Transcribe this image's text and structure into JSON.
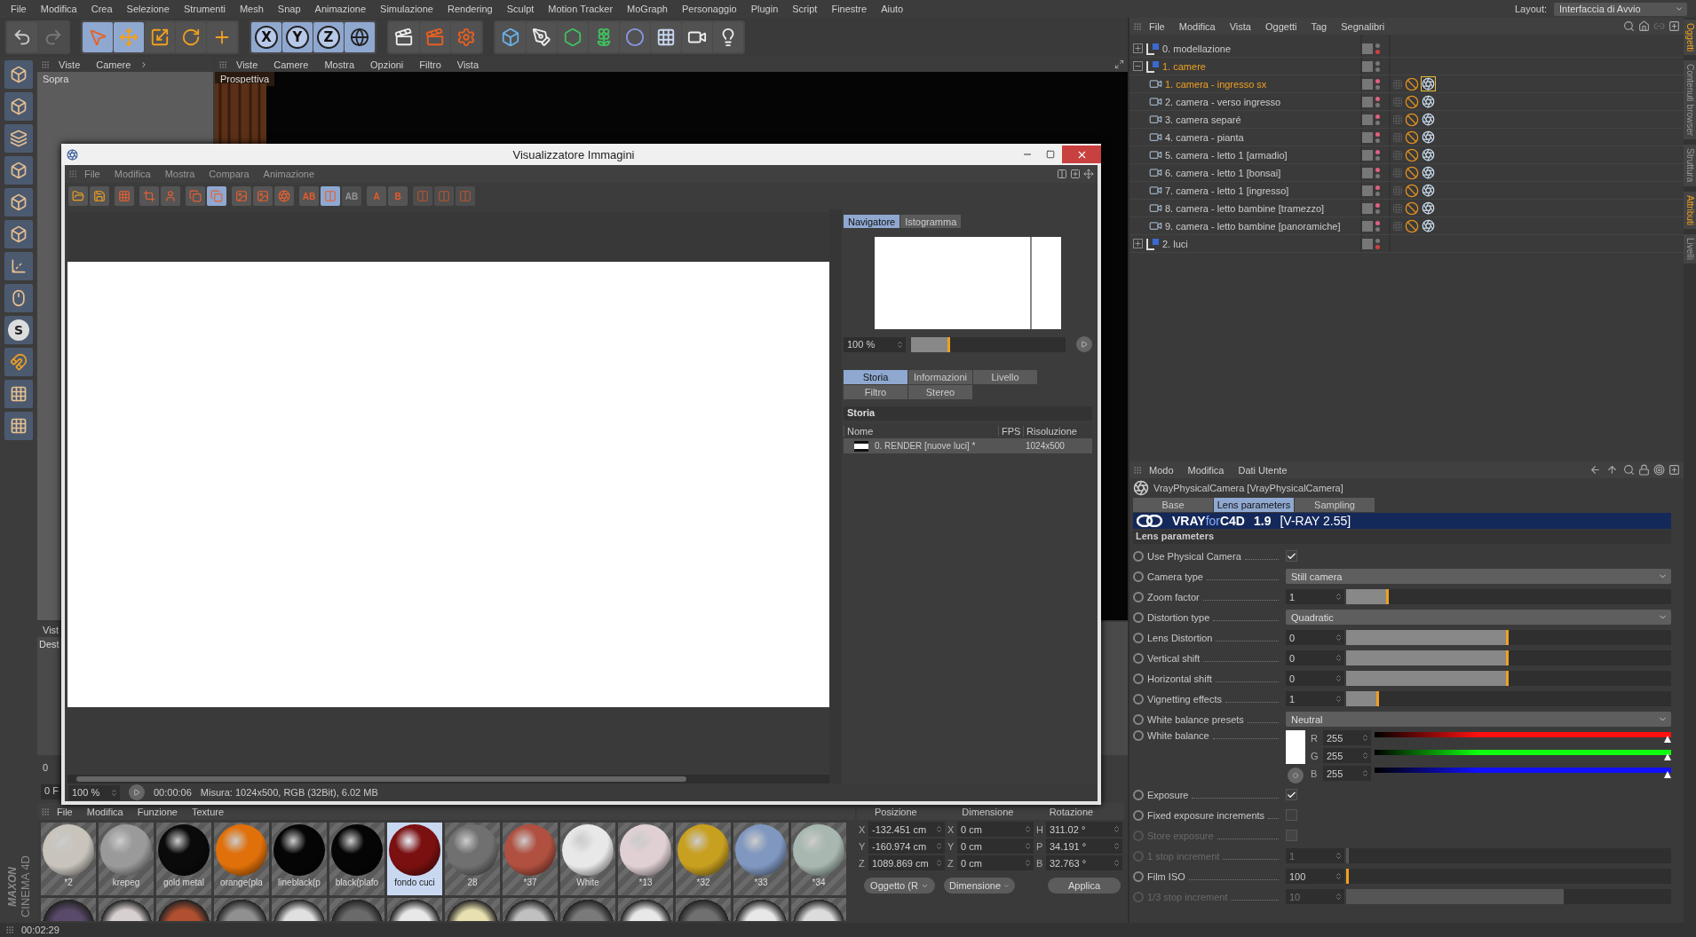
{
  "menu_bar": {
    "items": [
      "File",
      "Modifica",
      "Crea",
      "Selezione",
      "Strumenti",
      "Mesh",
      "Snap",
      "Animazione",
      "Simulazione",
      "Rendering",
      "Sculpt",
      "Motion Tracker",
      "MoGraph",
      "Personaggio",
      "Plugin",
      "Script",
      "Finestre",
      "Aiuto"
    ],
    "layout_label": "Layout:",
    "layout_value": "Interfaccia di Avvio"
  },
  "main_toolbar": [
    {
      "selected": false,
      "disabled": false
    },
    {
      "selected": false,
      "disabled": true
    },
    {
      "selected": true,
      "disabled": false
    },
    {
      "selected": true,
      "disabled": false
    },
    {
      "selected": false,
      "disabled": false
    },
    {
      "selected": false,
      "disabled": false
    },
    {
      "selected": false,
      "disabled": false
    },
    {
      "label": "X",
      "selected": true,
      "disabled": false
    },
    {
      "label": "Y",
      "selected": true,
      "disabled": false
    },
    {
      "label": "Z",
      "selected": true,
      "disabled": false
    },
    {
      "selected": true,
      "disabled": false
    },
    {
      "selected": false,
      "disabled": false
    },
    {
      "selected": false,
      "disabled": false
    },
    {
      "selected": false,
      "disabled": false
    },
    {
      "selected": false,
      "disabled": false
    },
    {
      "selected": false,
      "disabled": false
    },
    {
      "selected": false,
      "disabled": false
    },
    {
      "selected": false,
      "disabled": false
    },
    {
      "selected": false,
      "disabled": false
    },
    {
      "selected": false,
      "disabled": false
    },
    {
      "selected": false,
      "disabled": false
    },
    {
      "selected": false,
      "disabled": false
    }
  ],
  "left_toolbar": {
    "snap_label": "S"
  },
  "viewports": {
    "top": {
      "menus": [
        "Viste",
        "Camere"
      ],
      "label": "Sopra"
    },
    "perspective": {
      "menus": [
        "Viste",
        "Camere",
        "Mostra",
        "Opzioni",
        "Filtro",
        "Vista"
      ],
      "label": "Prospettiva"
    },
    "lower_left": {
      "menu": "Vist",
      "label": "Dest"
    }
  },
  "timeline": {
    "start": "0",
    "frame": "0 F"
  },
  "image_viewer": {
    "title": "Visualizzatore Immagini",
    "menus": [
      "File",
      "Modifica",
      "Mostra",
      "Compara",
      "Animazione"
    ],
    "toolbar": [
      {
        "selected": false,
        "disabled": false
      },
      {
        "selected": false,
        "disabled": false
      },
      {
        "selected": false,
        "disabled": false
      },
      {
        "selected": false,
        "disabled": false
      },
      {
        "selected": false,
        "disabled": false
      },
      {
        "selected": false,
        "disabled": false
      },
      {
        "selected": true,
        "disabled": false
      },
      {
        "selected": false,
        "disabled": false
      },
      {
        "selected": false,
        "disabled": false
      },
      {
        "selected": false,
        "disabled": false
      },
      {
        "label": "AB",
        "selected": false,
        "disabled": false
      },
      {
        "selected": true,
        "disabled": false
      },
      {
        "label": "AB",
        "selected": false,
        "disabled": true
      },
      {
        "label": "A",
        "selected": false,
        "disabled": false
      },
      {
        "label": "B",
        "selected": false,
        "disabled": false
      },
      {
        "selected": false,
        "disabled": true
      },
      {
        "selected": false,
        "disabled": true
      },
      {
        "selected": false,
        "disabled": true
      }
    ],
    "panel_tabs": [
      {
        "label": "Navigatore",
        "selected": true
      },
      {
        "label": "Istogramma",
        "selected": false
      }
    ],
    "zoom": {
      "value": "100 %",
      "level": 0.25
    },
    "info_tabs": [
      {
        "label": "Storia",
        "selected": true
      },
      {
        "label": "Informazioni",
        "selected": false
      },
      {
        "label": "Livello",
        "selected": false
      },
      {
        "label": "Filtro",
        "selected": false
      },
      {
        "label": "Stereo",
        "selected": false
      }
    ],
    "history": {
      "title": "Storia",
      "columns": [
        "Nome",
        "FPS",
        "Risoluzione"
      ],
      "rows": [
        {
          "name": "0. RENDER [nuove luci] *",
          "fps": "",
          "resolution": "1024x500"
        }
      ]
    },
    "status": {
      "zoom": "100 %",
      "time": "00:00:06",
      "info": "Misura: 1024x500, RGB (32Bit), 6.02 MB"
    }
  },
  "object_manager": {
    "menus": [
      "File",
      "Modifica",
      "Vista",
      "Oggetti",
      "Tag",
      "Segnalibri"
    ],
    "tree": [
      {
        "name": "0. modellazione",
        "kind": "layer",
        "expanded": false,
        "selected": false
      },
      {
        "name": "1. camere",
        "kind": "layer",
        "expanded": true,
        "selected": true,
        "children": [
          {
            "name": "1. camera - ingresso sx",
            "kind": "camera",
            "selected": true,
            "tag_selected": true
          },
          {
            "name": "2. camera - verso ingresso",
            "kind": "camera",
            "selected": false,
            "tag_selected": false
          },
          {
            "name": "3. camera separé",
            "kind": "camera",
            "selected": false,
            "tag_selected": false
          },
          {
            "name": "4. camera - pianta",
            "kind": "camera",
            "selected": false,
            "tag_selected": false
          },
          {
            "name": "5. camera - letto 1 [armadio]",
            "kind": "camera",
            "selected": false,
            "tag_selected": false
          },
          {
            "name": "6. camera - letto 1 [bonsai]",
            "kind": "camera",
            "selected": false,
            "tag_selected": false
          },
          {
            "name": "7. camera - letto 1 [ingresso]",
            "kind": "camera",
            "selected": false,
            "tag_selected": false
          },
          {
            "name": "8. camera - letto bambine [tramezzo]",
            "kind": "camera",
            "selected": false,
            "tag_selected": false
          },
          {
            "name": "9. camera - letto bambine [panoramiche]",
            "kind": "camera",
            "selected": false,
            "tag_selected": false
          }
        ]
      },
      {
        "name": "2. luci",
        "kind": "layer",
        "expanded": false,
        "selected": false
      }
    ]
  },
  "attributes": {
    "menus": [
      "Modo",
      "Modifica",
      "Dati Utente"
    ],
    "object_title": "VrayPhysicalCamera [VrayPhysicalCamera]",
    "tabs": [
      {
        "label": "Base",
        "selected": false
      },
      {
        "label": "Lens parameters",
        "selected": true
      },
      {
        "label": "Sampling",
        "selected": false
      }
    ],
    "banner": {
      "brand_bold": "VRAY",
      "brand_light": "for",
      "brand_end": "C4D",
      "version": "1.9",
      "engine": "[V-RAY 2.55]"
    },
    "section": "Lens parameters",
    "params": [
      {
        "kind": "checkbox",
        "label": "Use Physical Camera",
        "checked": true,
        "disabled": false
      },
      {
        "kind": "dropdown",
        "label": "Camera type",
        "value": "Still camera"
      },
      {
        "kind": "slider",
        "label": "Zoom factor",
        "value": "1",
        "level": 0.13,
        "disabled": false
      },
      {
        "kind": "dropdown",
        "label": "Distortion type",
        "value": "Quadratic"
      },
      {
        "kind": "slider",
        "label": "Lens Distortion",
        "value": "0",
        "level": 0.5,
        "disabled": false
      },
      {
        "kind": "slider",
        "label": "Vertical shift",
        "value": "0",
        "level": 0.5,
        "disabled": false
      },
      {
        "kind": "slider",
        "label": "Horizontal shift",
        "value": "0",
        "level": 0.5,
        "disabled": false
      },
      {
        "kind": "slider",
        "label": "Vignetting effects",
        "value": "1",
        "level": 0.1,
        "disabled": false
      },
      {
        "kind": "dropdown",
        "label": "White balance presets",
        "value": "Neutral"
      },
      {
        "kind": "color",
        "label": "White balance",
        "channels": [
          {
            "name": "R",
            "value": "255",
            "color": "#ff1010",
            "level": 1
          },
          {
            "name": "G",
            "value": "255",
            "color": "#10ff10",
            "level": 1
          },
          {
            "name": "B",
            "value": "255",
            "color": "#1010ff",
            "level": 1
          }
        ]
      },
      {
        "kind": "checkbox",
        "label": "Exposure",
        "checked": true,
        "disabled": false
      },
      {
        "kind": "checkbox",
        "label": "Fixed exposure increments",
        "checked": false,
        "disabled": false
      },
      {
        "kind": "checkbox",
        "label": "Store exposure",
        "checked": false,
        "disabled": true
      },
      {
        "kind": "slider",
        "label": "1 stop increment",
        "value": "1",
        "level": 0,
        "disabled": true
      },
      {
        "kind": "slider",
        "label": "Film ISO",
        "value": "100",
        "level": 0,
        "disabled": false
      },
      {
        "kind": "slider",
        "label": "1/3 stop increment",
        "value": "10",
        "level": 0.67,
        "disabled": true
      }
    ]
  },
  "side_tabs": [
    {
      "label": "Oggetti",
      "selected": true
    },
    {
      "label": "Contenuti browser",
      "selected": false
    },
    {
      "label": "Struttura",
      "selected": false
    },
    {
      "label": "Attributi",
      "selected": true
    },
    {
      "label": "Livelli",
      "selected": false
    }
  ],
  "materials": {
    "menus": [
      "File",
      "Modifica",
      "Funzione",
      "Texture"
    ],
    "items": [
      {
        "name": "*2",
        "color": "#c8c4bc",
        "selected": false
      },
      {
        "name": "krepeg",
        "color": "#9a9a9a",
        "selected": false
      },
      {
        "name": "gold metal",
        "color": "#0a0a0a",
        "selected": false
      },
      {
        "name": "orange(pla",
        "color": "#e0700a",
        "selected": false
      },
      {
        "name": "lineblack(p",
        "color": "#050505",
        "selected": false
      },
      {
        "name": "black(plafo",
        "color": "#050505",
        "selected": false
      },
      {
        "name": "fondo cuci",
        "color": "#7a1010",
        "selected": true
      },
      {
        "name": "28",
        "color": "#707070",
        "selected": false
      },
      {
        "name": "*37",
        "color": "#b05040",
        "selected": false
      },
      {
        "name": "White",
        "color": "#e8e8e8",
        "selected": false
      },
      {
        "name": "*13",
        "color": "#e0d0d4",
        "selected": false
      },
      {
        "name": "*32",
        "color": "#c8a020",
        "selected": false
      },
      {
        "name": "*33",
        "color": "#8098c0",
        "selected": false
      },
      {
        "name": "*34",
        "color": "#a8b8b0",
        "selected": false
      }
    ],
    "next_row": [
      {
        "color": "#5a4a6a"
      },
      {
        "color": "#d8d0d0"
      },
      {
        "color": "#b05030"
      },
      {
        "color": "#909090"
      },
      {
        "color": "#e0e0e0"
      },
      {
        "color": "#6a6a6a"
      },
      {
        "color": "#e8e8e8"
      },
      {
        "color": "#e8e0b0"
      },
      {
        "color": "#c0c0c0"
      },
      {
        "color": "#7a7a7a"
      },
      {
        "color": "#e8e8e8"
      },
      {
        "color": "#707070"
      },
      {
        "color": "#e8e8e8"
      },
      {
        "color": "#dcdcdc"
      }
    ]
  },
  "coordinates": {
    "headers": [
      "Posizione",
      "Dimensione",
      "Rotazione"
    ],
    "rows": [
      {
        "axis": "X",
        "position": "-132.451 cm",
        "size_axis": "X",
        "size": "0 cm",
        "rot_axis": "H",
        "rotation": "311.02 °"
      },
      {
        "axis": "Y",
        "position": "-160.974 cm",
        "size_axis": "Y",
        "size": "0 cm",
        "rot_axis": "P",
        "rotation": "34.191 °"
      },
      {
        "axis": "Z",
        "position": "1089.869 cm",
        "size_axis": "Z",
        "size": "0 cm",
        "rot_axis": "B",
        "rotation": "32.763 °"
      }
    ],
    "dropdowns": [
      "Oggetto (R",
      "Dimensione"
    ],
    "apply": "Applica"
  },
  "logo": {
    "brand": "MAXON",
    "product": "CINEMA 4D"
  },
  "status_bar": {
    "time": "00:02:29"
  }
}
